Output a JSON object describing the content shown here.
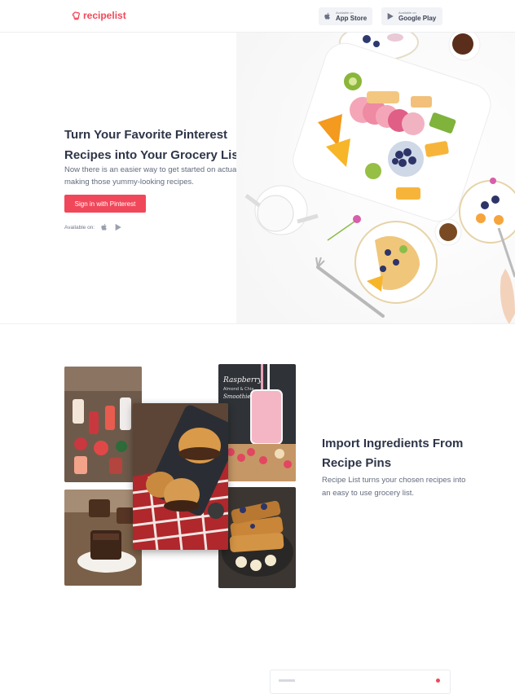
{
  "brand": {
    "name": "recipelist",
    "accent": "#f0485a"
  },
  "header": {
    "app_store": {
      "small": "Available on",
      "big": "App Store",
      "icon": "apple-icon"
    },
    "google_play": {
      "small": "Available on",
      "big": "Google Play",
      "icon": "play-icon"
    }
  },
  "hero": {
    "title": "Turn Your Favorite Pinterest Recipes into Your Grocery List",
    "subtitle": "Now there is an easier way to get started on actually making those yummy-looking recipes.",
    "cta": "Sign in with Pinterest",
    "available_label": "Available on:"
  },
  "section2": {
    "title": "Import Ingredients From Recipe Pins",
    "subtitle": "Recipe List turns your chosen recipes into an easy to use grocery list.",
    "smoothie_caption": "Raspberry Almond & Chia Smoothie"
  }
}
